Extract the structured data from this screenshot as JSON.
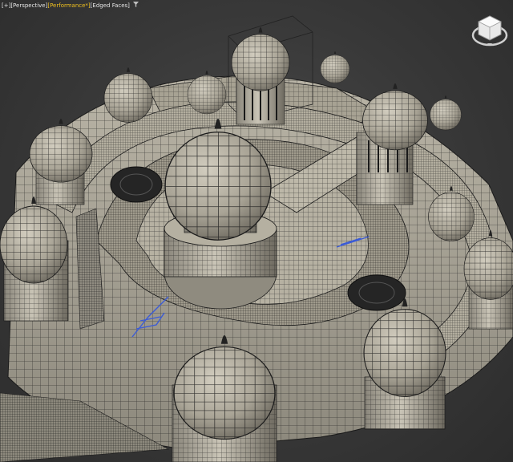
{
  "viewport": {
    "menu": {
      "plus": "[+]",
      "view": "[Perspective]",
      "shading": "[Performance*]",
      "edges": "[Edged Faces]"
    },
    "filter_icon": "filter-icon",
    "colors": {
      "accent": "#f0c020",
      "label_text": "#e6e6e6",
      "background": "#383838",
      "mesh_fill": "#b7b2a5",
      "mesh_shadow": "#6f6b62",
      "wire": "#1a1a1a",
      "selection_wire": "#3b5bd6"
    }
  },
  "viewcube": {
    "icon": "viewcube-icon"
  }
}
